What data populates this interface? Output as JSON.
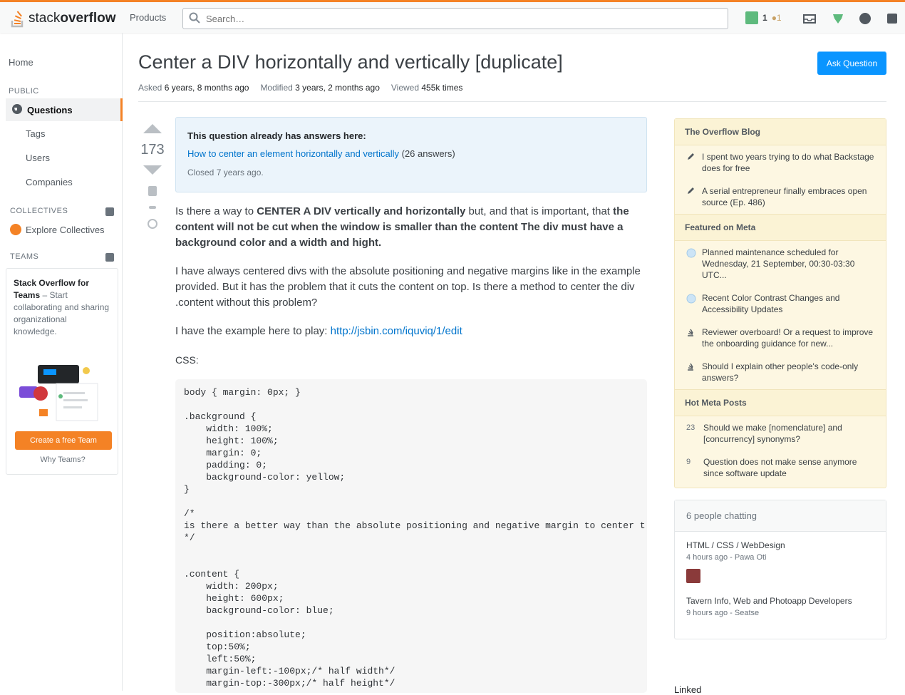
{
  "header": {
    "logo_text_plain": "stack",
    "logo_text_bold": "overflow",
    "products_label": "Products",
    "search_placeholder": "Search…",
    "reputation": "1",
    "badges": "●1",
    "icons": [
      "inbox-icon",
      "achievements-icon",
      "help-icon",
      "site-switcher-icon"
    ]
  },
  "leftnav": {
    "home": "Home",
    "public_label": "PUBLIC",
    "questions": "Questions",
    "tags": "Tags",
    "users": "Users",
    "companies": "Companies",
    "collectives_label": "COLLECTIVES",
    "explore_collectives": "Explore Collectives",
    "teams_label": "TEAMS",
    "teams_title": "Stack Overflow for Teams",
    "teams_desc": " – Start collaborating and sharing organizational knowledge.",
    "teams_button": "Create a free Team",
    "why_teams": "Why Teams?"
  },
  "question": {
    "title": "Center a DIV horizontally and vertically [duplicate]",
    "ask_button": "Ask Question",
    "asked_label": "Asked",
    "asked_value": "6 years, 8 months ago",
    "modified_label": "Modified",
    "modified_value": "3 years, 2 months ago",
    "viewed_label": "Viewed",
    "viewed_value": "455k times",
    "votes": "173",
    "duplicate_header": "This question already has answers here:",
    "duplicate_link": "How to center an element horizontally and vertically",
    "duplicate_answers": "(26 answers)",
    "closed": "Closed 7 years ago.",
    "body_p1_a": "Is there a way to ",
    "body_p1_b": "CENTER A DIV vertically and horizontally",
    "body_p1_c": " but, and that is important, that ",
    "body_p1_d": "the content will not be cut when the window is smaller than the content",
    "body_p1_e": " ",
    "body_p1_f": "The div must have a background color and a width and hight.",
    "body_p2": "I have always centered divs with the absolute positioning and negative margins like in the example provided. But it has the problem that it cuts the content on top. Is there a method to center the div .content without this problem?",
    "body_p3_text": "I have the example here to play: ",
    "body_p3_link": "http://jsbin.com/iquviq/1/edit",
    "css_label": "CSS:",
    "code": "body { margin: 0px; }\n\n.background {\n    width: 100%;\n    height: 100%;\n    margin: 0;\n    padding: 0;\n    background-color: yellow;\n}\n\n/*\nis there a better way than the absolute positioning and negative margin to center t\n*/\n\n\n.content {\n    width: 200px;\n    height: 600px;\n    background-color: blue;\n\n    position:absolute;\n    top:50%;\n    left:50%;\n    margin-left:-100px;/* half width*/\n    margin-top:-300px;/* half height*/"
  },
  "sidebar": {
    "blog_header": "The Overflow Blog",
    "blog_items": [
      "I spent two years trying to do what Backstage does for free",
      "A serial entrepreneur finally embraces open source (Ep. 486)"
    ],
    "featured_header": "Featured on Meta",
    "featured_items": [
      "Planned maintenance scheduled for Wednesday, 21 September, 00:30-03:30 UTC...",
      "Recent Color Contrast Changes and Accessibility Updates",
      "Reviewer overboard! Or a request to improve the onboarding guidance for new...",
      "Should I explain other people's code-only answers?"
    ],
    "hot_meta_header": "Hot Meta Posts",
    "hot_meta_items": [
      {
        "count": "23",
        "text": "Should we make [nomenclature] and [concurrency] synonyms?"
      },
      {
        "count": "9",
        "text": "Question does not make sense anymore since software update"
      }
    ],
    "chat_header": "6 people chatting",
    "chat_room_1": "HTML / CSS / WebDesign",
    "chat_room_1_sub": "4 hours ago - Pawa Oti",
    "chat_room_2": "Tavern Info, Web and Photoapp Developers",
    "chat_room_2_sub": "9 hours ago - Seatse",
    "linked": "Linked"
  }
}
